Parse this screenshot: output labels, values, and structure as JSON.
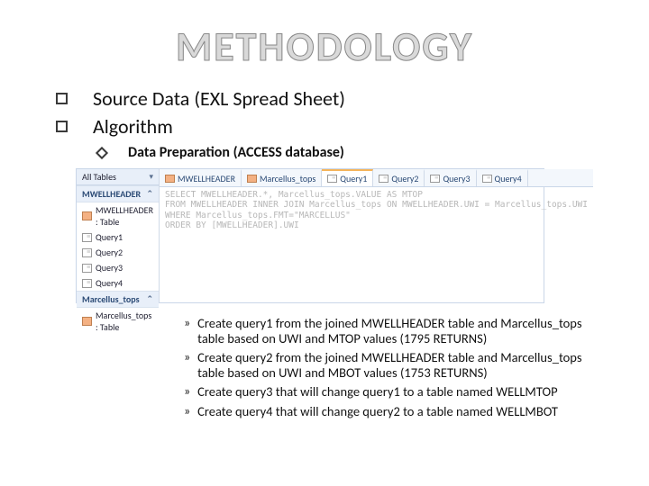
{
  "title": "METHODOLOGY",
  "bullets_l1": [
    "Source Data (EXL Spread Sheet)",
    "Algorithm"
  ],
  "bullets_l2": [
    "Data Preparation (ACCESS database)"
  ],
  "access": {
    "nav": {
      "header": "All Tables",
      "groups": [
        {
          "name": "MWELLHEADER",
          "items": [
            "MWELLHEADER : Table",
            "Query1",
            "Query2",
            "Query3",
            "Query4"
          ]
        },
        {
          "name": "Marcellus_tops",
          "items": [
            "Marcellus_tops : Table"
          ]
        }
      ]
    },
    "tabs": [
      "MWELLHEADER",
      "Marcellus_tops",
      "Query1",
      "Query2",
      "Query3",
      "Query4"
    ],
    "sql": "SELECT MWELLHEADER.*, Marcellus_tops.VALUE AS MTOP\nFROM MWELLHEADER INNER JOIN Marcellus_tops ON MWELLHEADER.UWI = Marcellus_tops.UWI\nWHERE Marcellus_tops.FMT=\"MARCELLUS\"\nORDER BY [MWELLHEADER].UWI"
  },
  "steps": [
    "Create query1 from the joined MWELLHEADER table and Marcellus_tops table based on UWI and MTOP values (1795 RETURNS)",
    " Create query2 from the joined MWELLHEADER table and Marcellus_tops table based on UWI and MBOT values (1753 RETURNS)",
    "Create query3 that will change query1 to a table named WELLMTOP",
    "Create query4 that will change query2 to a table named WELLMBOT"
  ]
}
